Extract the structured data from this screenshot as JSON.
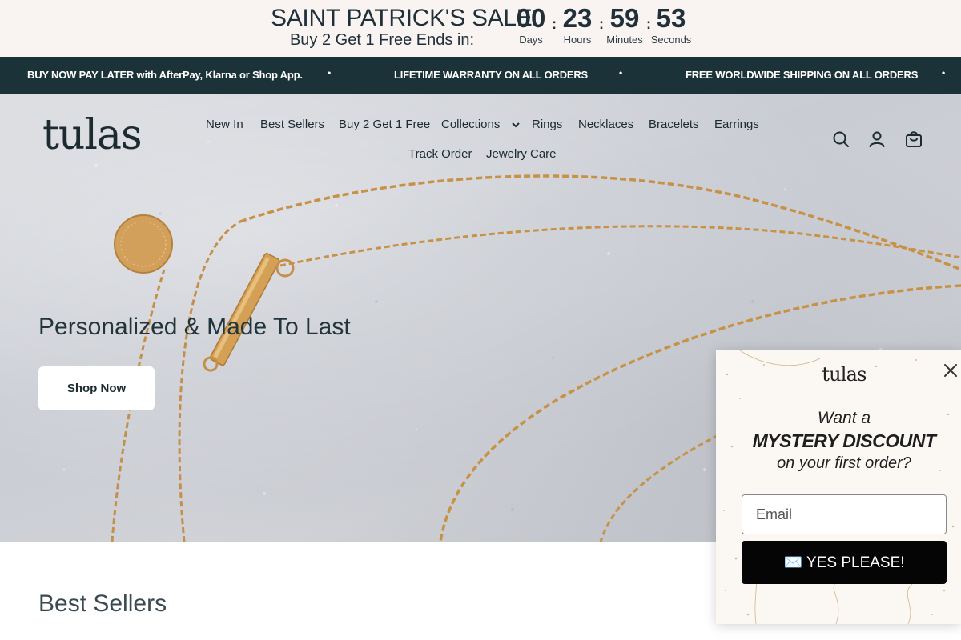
{
  "countdown": {
    "title": "SAINT PATRICK'S SALE",
    "subtitle": "Buy 2 Get 1 Free Ends in:",
    "units": [
      {
        "value": "00",
        "label": "Days"
      },
      {
        "value": "23",
        "label": "Hours"
      },
      {
        "value": "59",
        "label": "Minutes"
      },
      {
        "value": "53",
        "label": "Seconds"
      }
    ],
    "separator": ":"
  },
  "announcement": {
    "items": [
      "BUY NOW PAY LATER with AfterPay, Klarna or Shop App.",
      "LIFETIME WARRANTY ON ALL ORDERS",
      "FREE WORLDWIDE SHIPPING ON ALL ORDERS"
    ],
    "dot": "•",
    "background": "#1c3239"
  },
  "header": {
    "logo": "tulas",
    "nav": [
      "New In",
      "Best Sellers",
      "Buy 2 Get 1 Free",
      "Collections",
      "Rings",
      "Necklaces",
      "Bracelets",
      "Earrings",
      "Track Order",
      "Jewelry Care"
    ],
    "icons": [
      "search-icon",
      "account-icon",
      "cart-icon"
    ]
  },
  "hero": {
    "heading": "Personalized & Made To Last",
    "button": "Shop Now"
  },
  "best_sellers": {
    "title": "Best Sellers"
  },
  "popup": {
    "logo": "tulas",
    "line1": "Want a",
    "line2": "MYSTERY DISCOUNT",
    "line3": "on your first order?",
    "email_placeholder": "Email",
    "submit": "✉️ YES PLEASE!"
  }
}
